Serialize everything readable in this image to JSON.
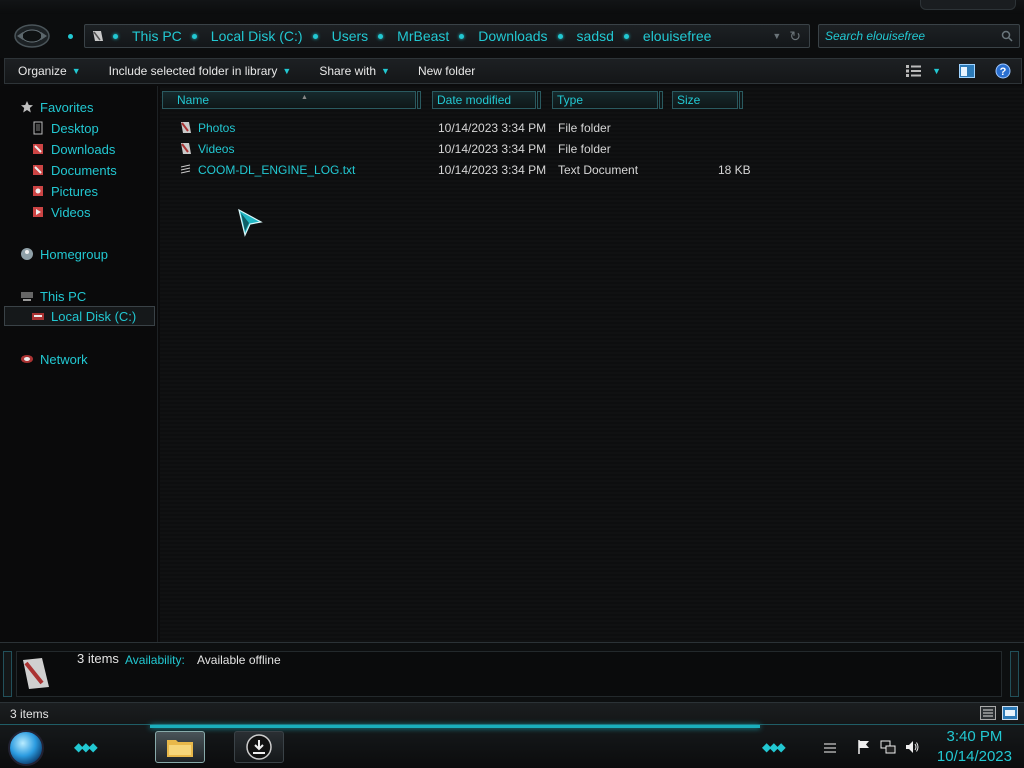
{
  "address_bar": {
    "breadcrumbs": [
      "This PC",
      "Local Disk (C:)",
      "Users",
      "MrBeast",
      "Downloads",
      "sadsd",
      "elouisefree"
    ]
  },
  "search": {
    "placeholder": "Search elouisefree"
  },
  "toolbar": {
    "organize": "Organize",
    "include_library": "Include selected folder in library",
    "share_with": "Share with",
    "new_folder": "New folder"
  },
  "navigation": {
    "favorites": "Favorites",
    "favorites_items": [
      "Desktop",
      "Downloads",
      "Documents",
      "Pictures",
      "Videos"
    ],
    "homegroup": "Homegroup",
    "this_pc": "This PC",
    "local_disk": "Local Disk (C:)",
    "network": "Network"
  },
  "columns": {
    "name": "Name",
    "date_modified": "Date modified",
    "type": "Type",
    "size": "Size"
  },
  "files": [
    {
      "name": "Photos",
      "date": "10/14/2023 3:34 PM",
      "type": "File folder",
      "size": ""
    },
    {
      "name": "Videos",
      "date": "10/14/2023 3:34 PM",
      "type": "File folder",
      "size": ""
    },
    {
      "name": "COOM-DL_ENGINE_LOG.txt",
      "date": "10/14/2023 3:34 PM",
      "type": "Text Document",
      "size": "18 KB"
    }
  ],
  "details_pane": {
    "item_count": "3 items",
    "availability_label": "Availability:",
    "availability_value": "Available offline"
  },
  "status_bar": {
    "text": "3 items"
  },
  "taskbar": {
    "time": "3:40 PM",
    "date": "10/14/2023"
  },
  "colors": {
    "accent": "#22c8d2",
    "background": "#0b0b0c"
  }
}
